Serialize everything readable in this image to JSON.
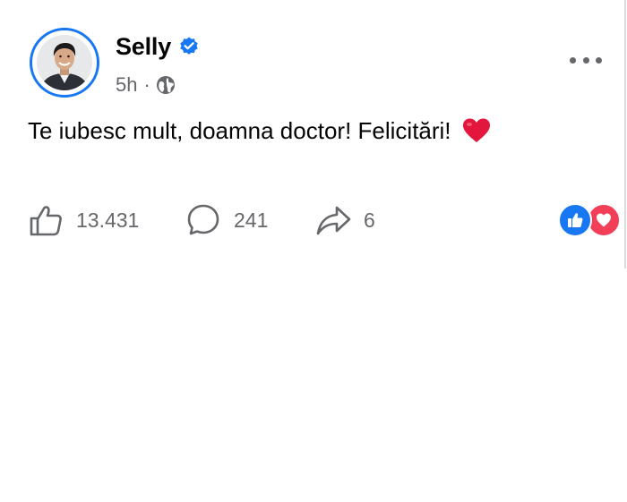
{
  "post": {
    "author": {
      "name": "Selly",
      "verified": true,
      "avatar": "profile-photo"
    },
    "meta": {
      "time": "5h",
      "separator": "·",
      "audience_icon": "globe-icon"
    },
    "text": "Te iubesc mult, doamna doctor! Felicitări!",
    "text_emoji": "red-heart-emoji",
    "actions": {
      "like_count": "13.431",
      "comment_count": "241",
      "share_count": "6"
    },
    "reactions": [
      "like-reaction-icon",
      "love-reaction-icon"
    ]
  },
  "colors": {
    "accent": "#1877f2",
    "love": "#f33e58",
    "secondary_text": "#65676b",
    "primary_text": "#050505",
    "heart": "#e3163d"
  }
}
